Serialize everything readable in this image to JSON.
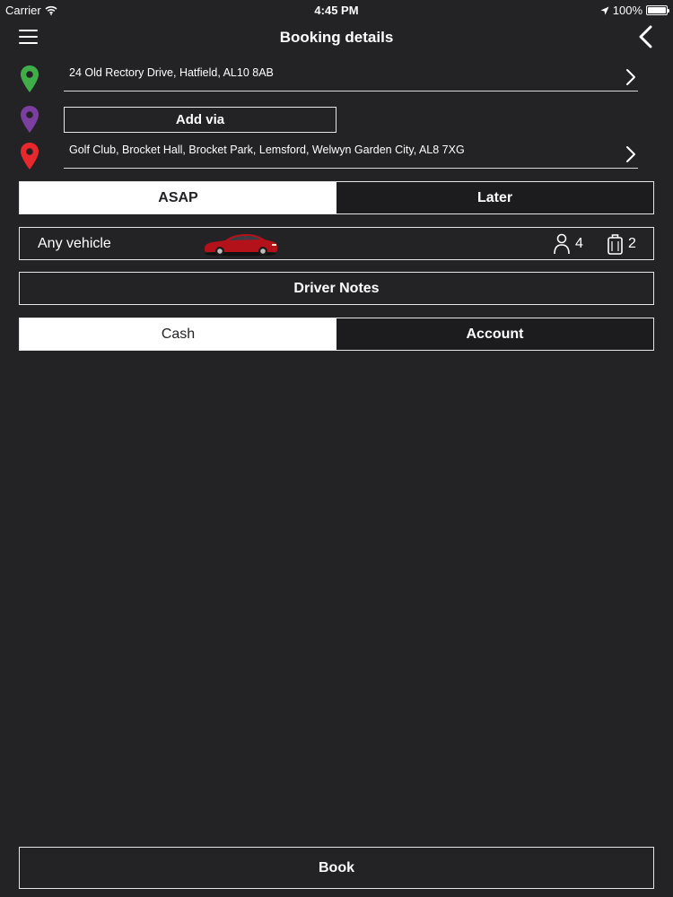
{
  "status_bar": {
    "carrier": "Carrier",
    "time": "4:45 PM",
    "battery": "100%",
    "icons": [
      "wifi-icon",
      "location-arrow-icon",
      "battery-icon"
    ]
  },
  "nav": {
    "title": "Booking details",
    "left_icon": "menu-icon",
    "right_icon": "back-chevron-icon"
  },
  "pickup": {
    "address": "24 Old Rectory Drive, Hatfield, AL10 8AB",
    "pin_color": "#3fae49"
  },
  "via": {
    "label": "Add via",
    "pin_color": "#7b3fa0"
  },
  "dropoff": {
    "address": "Golf Club, Brocket Hall, Brocket Park, Lemsford, Welwyn Garden City, AL8 7XG",
    "pin_color": "#e8282d"
  },
  "timing": {
    "options": [
      "ASAP",
      "Later"
    ],
    "selected": "ASAP"
  },
  "vehicle": {
    "label": "Any vehicle",
    "passengers": "4",
    "bags": "2",
    "car_color": "#b3121a"
  },
  "driver_notes": {
    "label": "Driver Notes"
  },
  "payment": {
    "options": [
      "Cash",
      "Account"
    ],
    "selected": "Cash"
  },
  "book": {
    "label": "Book"
  },
  "colors": {
    "background": "#232224",
    "text": "#ffffff",
    "border": "#e6e6e6"
  }
}
